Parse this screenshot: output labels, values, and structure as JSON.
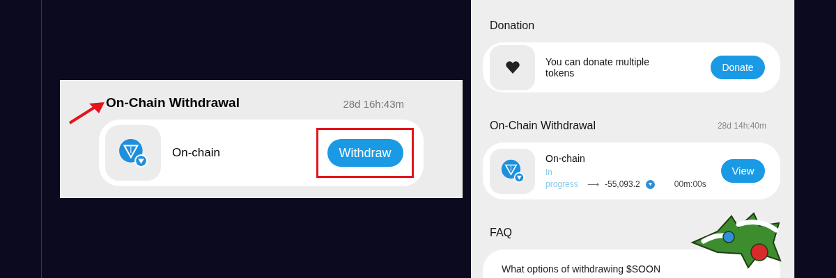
{
  "callout": {
    "title": "On-Chain Withdrawal",
    "timer": "28d 16h:43m",
    "item": {
      "name": "On-chain"
    },
    "button": "Withdraw"
  },
  "app": {
    "sections": [
      {
        "kind": "donation",
        "heading": "Donation",
        "text": "You can donate multiple tokens",
        "button": "Donate"
      },
      {
        "kind": "withdrawal",
        "heading": "On-Chain Withdrawal",
        "timer": "28d 14h:40m",
        "name": "On-chain",
        "status": "In progress",
        "arrow": "⟶",
        "amount": "-55,093.2",
        "duration": "00m:00s",
        "button": "View"
      },
      {
        "kind": "faq",
        "heading": "FAQ",
        "question": "What options of withdrawing $SOON"
      }
    ]
  }
}
